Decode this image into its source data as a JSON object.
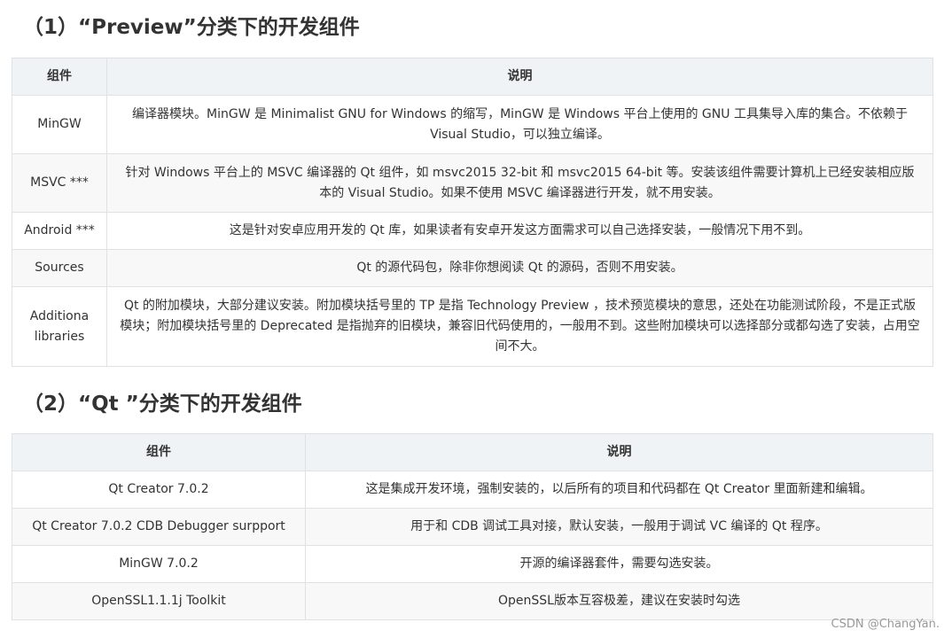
{
  "section1": {
    "title": "（1）“Preview”分类下的开发组件",
    "headers": [
      "组件",
      "说明"
    ],
    "rows": [
      {
        "name": "MinGW",
        "desc": "编译器模块。MinGW 是 Minimalist GNU for Windows 的缩写，MinGW 是 Windows 平台上使用的 GNU 工具集导入库的集合。不依赖于 Visual Studio，可以独立编译。"
      },
      {
        "name": "MSVC ***",
        "desc": "针对 Windows 平台上的 MSVC 编译器的 Qt 组件，如 msvc2015 32-bit 和 msvc2015 64-bit 等。安装该组件需要计算机上已经安装相应版本的 Visual Studio。如果不使用 MSVC 编译器进行开发，就不用安装。"
      },
      {
        "name": "Android ***",
        "desc": "这是针对安卓应用开发的 Qt 库，如果读者有安卓开发这方面需求可以自己选择安装，一般情况下用不到。"
      },
      {
        "name": "Sources",
        "desc": "Qt 的源代码包，除非你想阅读 Qt 的源码，否则不用安装。"
      },
      {
        "name": "Additiona libraries",
        "desc": "Qt 的附加模块，大部分建议安装。附加模块括号里的 TP 是指 Technology Preview ，技术预览模块的意思，还处在功能测试阶段，不是正式版模块；附加模块括号里的 Deprecated 是指抛弃的旧模块，兼容旧代码使用的，一般用不到。这些附加模块可以选择部分或都勾选了安装，占用空间不大。"
      }
    ]
  },
  "section2": {
    "title": "（2）“Qt ”分类下的开发组件",
    "headers": [
      "组件",
      "说明"
    ],
    "rows": [
      {
        "name": "Qt Creator 7.0.2",
        "desc": "这是集成开发环境，强制安装的，以后所有的项目和代码都在 Qt Creator 里面新建和编辑。"
      },
      {
        "name": "Qt Creator 7.0.2 CDB Debugger surpport",
        "desc": "用于和 CDB 调试工具对接，默认安装，一般用于调试 VC 编译的 Qt 程序。"
      },
      {
        "name": "MinGW 7.0.2",
        "desc": "开源的编译器套件，需要勾选安装。"
      },
      {
        "name": "OpenSSL1.1.1j Toolkit",
        "desc": "OpenSSL版本互容极差，建议在安装时勾选"
      }
    ]
  },
  "watermark": "CSDN @ChangYan."
}
